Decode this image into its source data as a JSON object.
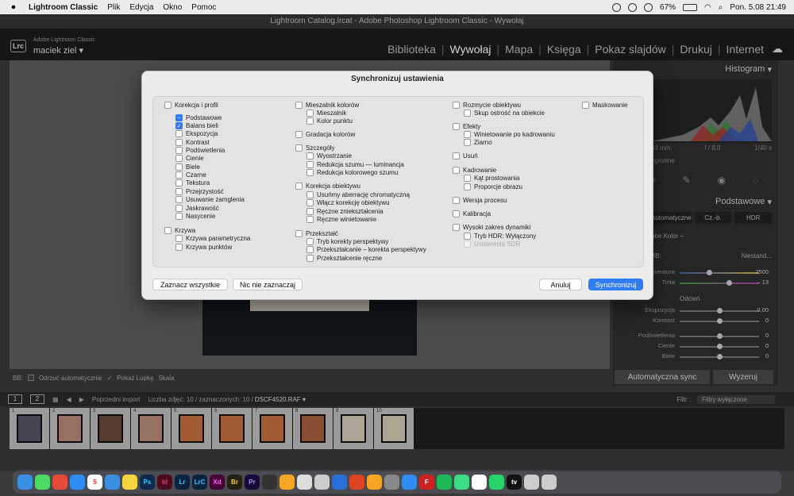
{
  "menubar": {
    "app": "Lightroom Classic",
    "menus": [
      "Plik",
      "Edycja",
      "Okno",
      "Pomoc"
    ],
    "battery": "67%",
    "clock": "Pon. 5.08  21:49"
  },
  "window_title": "Lightroom Catalog.lrcat - Adobe Photoshop Lightroom Classic - Wywołaj",
  "lr": {
    "product": "Adobe Lightroom Classic",
    "user": "maciek ziel",
    "modules": [
      "Biblioteka",
      "Wywołaj",
      "Mapa",
      "Księga",
      "Pokaz slajdów",
      "Drukuj",
      "Internet"
    ],
    "active_module": "Wywołaj"
  },
  "right_panel": {
    "histogram_label": "Histogram",
    "hist_info": [
      "63 mm",
      "f / 8,0",
      "1/40 s"
    ],
    "original": "yginalne",
    "podstawowe": "Podstawowe",
    "tabs": [
      "Automatyczne",
      "Cz.-b.",
      "HDR"
    ],
    "profile": "obe Kolor",
    "bb_label": "BB:",
    "bb_value": "Niestand...",
    "odcien": "Odcień",
    "sliders": [
      {
        "label": "peratura",
        "value": "2500"
      },
      {
        "label": "Tinta",
        "value": "– 13"
      },
      {
        "label": "Ekspozycja",
        "value": "0,00"
      },
      {
        "label": "Kontrast",
        "value": "0"
      },
      {
        "label": "Podświetlenia",
        "value": "0"
      },
      {
        "label": "Cienie",
        "value": "0"
      },
      {
        "label": "Biele",
        "value": "0"
      }
    ],
    "auto_sync": "Automatyczna sync",
    "reset": "Wyzeruj"
  },
  "toolbar": {
    "bb": "BB:",
    "odrzuc": "Odrzuć automatycznie",
    "lupka": "Pokaż Lupkę",
    "skala": "Skala"
  },
  "filmstrip": {
    "prev": "Poprzedni import",
    "count": "Liczba zdjęć: 10 / zaznaczonych: 10 /",
    "file": "DSCF4520.RAF",
    "filter_label": "Filtr :",
    "filter_value": "Filtry wyłączone",
    "thumbs": [
      "1",
      "2",
      "3",
      "4",
      "5",
      "6",
      "7",
      "8",
      "9",
      "10"
    ]
  },
  "dialog": {
    "title": "Synchronizuj ustawienia",
    "col1": [
      {
        "label": "Korekcja i profil",
        "checked": false
      },
      {
        "label": "Podstawowe",
        "checked": "mixed"
      },
      {
        "label": "Balans bieli",
        "checked": true
      },
      {
        "label": "Ekspozycja",
        "checked": false
      },
      {
        "label": "Kontrast",
        "checked": false
      },
      {
        "label": "Podświetlenia",
        "checked": false
      },
      {
        "label": "Cienie",
        "checked": false
      },
      {
        "label": "Biele",
        "checked": false
      },
      {
        "label": "Czarne",
        "checked": false
      },
      {
        "label": "Tekstura",
        "checked": false
      },
      {
        "label": "Przejrzystość",
        "checked": false
      },
      {
        "label": "Usuwanie zamglenia",
        "checked": false
      },
      {
        "label": "Jaskrawość",
        "checked": false
      },
      {
        "label": "Nasycenie",
        "checked": false
      },
      {
        "label": "Krzywa",
        "checked": false
      },
      {
        "label": "Krzywa parametryczna",
        "checked": false
      },
      {
        "label": "Krzywa punktów",
        "checked": false
      }
    ],
    "col2": [
      {
        "label": "Mieszalnik kolorów"
      },
      {
        "label": "Mieszalnik"
      },
      {
        "label": "Kolor punktu"
      },
      {
        "label": "Gradacja kolorów"
      },
      {
        "label": "Szczegóły"
      },
      {
        "label": "Wyostrzanie"
      },
      {
        "label": "Redukcja szumu — luminancja"
      },
      {
        "label": "Redukcja kolorowego szumu"
      },
      {
        "label": "Korekcja obiektywu"
      },
      {
        "label": "Usuńmy aberrację chromatyczną"
      },
      {
        "label": "Włącz korekcję obiektywu"
      },
      {
        "label": "Ręczne zniekształcenia"
      },
      {
        "label": "Ręczne winietowanie"
      },
      {
        "label": "Przekształć"
      },
      {
        "label": "Tryb korekty perspektywy"
      },
      {
        "label": "Przekształcanie – korekta perspektywy"
      },
      {
        "label": "Przekształcenie ręczne"
      }
    ],
    "col3": [
      {
        "label": "Rozmycie obiektywu"
      },
      {
        "label": "Skup ostrość na obiekcie"
      },
      {
        "label": "Efekty"
      },
      {
        "label": "Winietowanie po kadrowaniu"
      },
      {
        "label": "Ziarno"
      },
      {
        "label": "Usuń"
      },
      {
        "label": "Kadrowanie"
      },
      {
        "label": "Kąt prostowania"
      },
      {
        "label": "Proporcje obrazu"
      },
      {
        "label": "Wersja procesu"
      },
      {
        "label": "Kalibracja"
      },
      {
        "label": "Wysoki zakres dynamiki"
      },
      {
        "label": "Tryb HDR: Wyłączony"
      },
      {
        "label": "Ustawienia SDR"
      }
    ],
    "col4": [
      {
        "label": "Maskowanie"
      }
    ],
    "btn_select_all": "Zaznacz wszystkie",
    "btn_select_none": "Nic nie zaznaczaj",
    "btn_cancel": "Anuluj",
    "btn_sync": "Synchronizuj"
  },
  "dock": [
    "Finder",
    "Messages",
    "Chrome",
    "Safari",
    "Calendar",
    "Mail",
    "Notes",
    "Ps",
    "Id",
    "Lr",
    "LrC",
    "Xd",
    "Br",
    "Pr",
    "DaVinci",
    "Photos",
    "Preview",
    "Stack",
    "Keynote",
    "Acrobat",
    "Pages",
    "Settings",
    "App Store",
    "FileZilla",
    "Spotify",
    "Android",
    "OpenAI",
    "WhatsApp",
    "Apple TV",
    "Downloads",
    "Trash"
  ]
}
